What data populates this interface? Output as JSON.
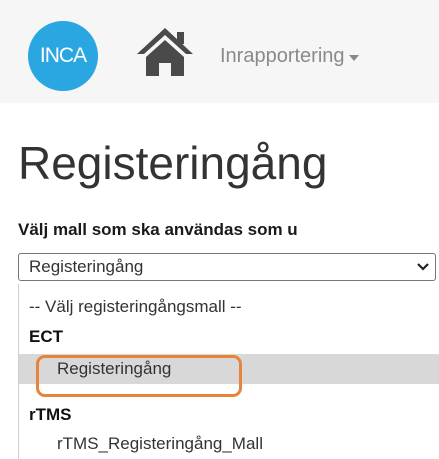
{
  "navbar": {
    "logo_text": "INCA",
    "home_icon": "home-icon",
    "menu_label": "Inrapportering",
    "menu_caret_icon": "caret-down-icon"
  },
  "page": {
    "title": "Registeringång"
  },
  "template_select": {
    "label": "Välj mall som ska användas som u",
    "selected_value": "Registeringång",
    "chevron_icon": "chevron-down-icon",
    "options": {
      "placeholder": "-- Välj registeringångsmall --",
      "group_ect": "ECT",
      "ect_item": "Registeringång",
      "group_rtms": "rTMS",
      "rtms_item": "rTMS_Registeringång_Mall"
    }
  },
  "colors": {
    "logo": "#2aa7e0",
    "navbar_bg": "#f6f6f6",
    "highlight_outline": "#e8833a",
    "selected_bg": "#d8d8d8"
  }
}
